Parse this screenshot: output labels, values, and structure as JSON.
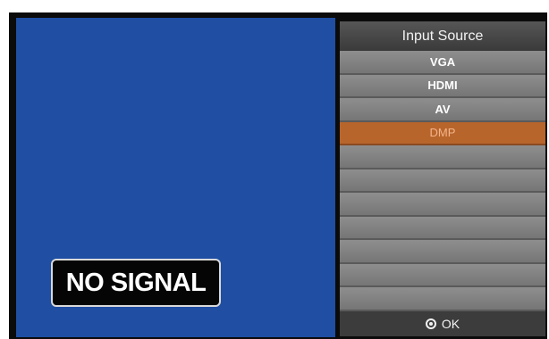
{
  "video": {
    "status_text": "NO SIGNAL"
  },
  "menu": {
    "title": "Input Source",
    "items": [
      {
        "label": "VGA",
        "selected": false
      },
      {
        "label": "HDMI",
        "selected": false
      },
      {
        "label": "AV",
        "selected": false
      },
      {
        "label": "DMP",
        "selected": true
      }
    ],
    "footer": {
      "icon": "ok-circle-icon",
      "label": "OK"
    }
  },
  "colors": {
    "video_background": "#1f4ea3",
    "selected_item": "#b8652c",
    "selected_text": "#f4b489"
  }
}
